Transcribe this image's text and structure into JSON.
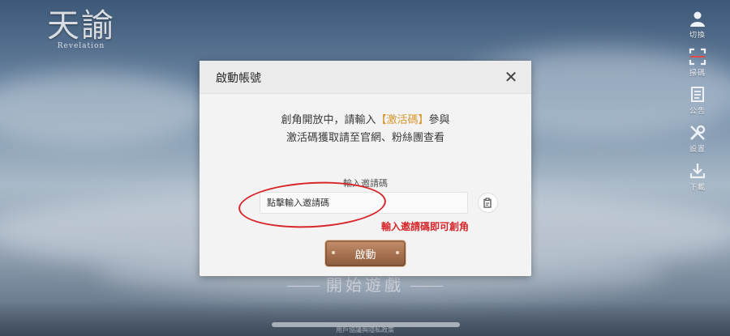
{
  "background": {
    "logo_main": "天諭",
    "logo_sub": "Revelation",
    "start_label": "開始遊戲",
    "footer_text": "用戶協議與隱私政策"
  },
  "sidebar": {
    "items": [
      {
        "label": "切換",
        "icon": "user-switch-icon"
      },
      {
        "label": "掃碼",
        "icon": "scan-icon"
      },
      {
        "label": "公告",
        "icon": "notice-icon"
      },
      {
        "label": "設置",
        "icon": "settings-icon"
      },
      {
        "label": "下載",
        "icon": "download-icon"
      }
    ]
  },
  "dialog": {
    "title": "啟動帳號",
    "close_symbol": "✕",
    "message_line1_pre": "創角開放中，請輸入",
    "message_line1_highlight": "【激活碼】",
    "message_line1_post": "參與",
    "message_line2": "激活碼獲取請至官網、粉絲團查看",
    "field_label": "輸入邀請碼",
    "input_placeholder": "點擊輸入邀請碼",
    "input_value": "",
    "annotation_text": "輸入邀請碼即可創角",
    "activate_label": "啟動"
  },
  "colors": {
    "highlight": "#d9952b",
    "annotation": "#d8262a",
    "button": "#a4704f"
  }
}
